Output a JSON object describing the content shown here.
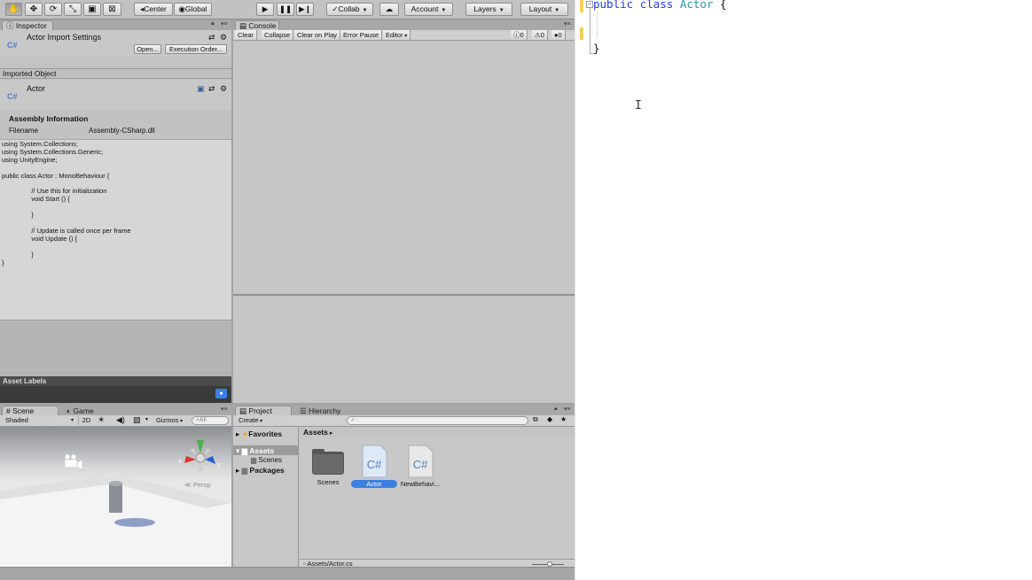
{
  "toolbar": {
    "tools": [
      "hand-tool",
      "move-tool",
      "rotate-tool",
      "scale-tool",
      "rect-tool",
      "transform-tool"
    ],
    "pivot_label": "Center",
    "space_label": "Global",
    "collab_label": "Collab",
    "account_label": "Account",
    "layers_label": "Layers",
    "layout_label": "Layout"
  },
  "inspector": {
    "tab_label": "Inspector",
    "title": "Actor Import Settings",
    "icon_text": "C#",
    "open_button": "Open...",
    "execution_order_button": "Execution Order...",
    "imported_object_header": "Imported Object",
    "object_name": "Actor",
    "assembly_header": "Assembly Information",
    "filename_label": "Filename",
    "filename_value": "Assembly-CSharp.dll",
    "code_preview": "using System.Collections;\nusing System.Collections.Generic;\nusing UnityEngine;\n\npublic class Actor : MonoBehaviour {\n\n\t\t// Use this for initialization\n\t\tvoid Start () {\n\n\t\t}\n\n\t\t// Update is called once per frame\n\t\tvoid Update () {\n\n\t\t}\n}",
    "asset_labels_header": "Asset Labels"
  },
  "console": {
    "tab_label": "Console",
    "buttons": [
      "Clear",
      "Collapse",
      "Clear on Play",
      "Error Pause",
      "Editor"
    ],
    "info_count": "0",
    "warning_count": "0",
    "error_count": "0"
  },
  "scene": {
    "tab_scene": "Scene",
    "tab_game": "Game",
    "shading_mode": "Shaded",
    "mode_2d": "2D",
    "gizmos_label": "Gizmos",
    "search_all": "All",
    "persp_label": "Persp",
    "axis_x": "x",
    "axis_z": "z"
  },
  "project": {
    "tab_project": "Project",
    "tab_hierarchy": "Hierarchy",
    "create_label": "Create",
    "favorites_label": "Favorites",
    "tree": [
      "Assets",
      "Scenes",
      "Packages"
    ],
    "breadcrumb": "Assets",
    "assets": [
      {
        "name": "Scenes",
        "type": "folder"
      },
      {
        "name": "Actor",
        "type": "script",
        "selected": true
      },
      {
        "name": "NewBehavi...",
        "type": "script",
        "selected": false
      }
    ],
    "status_path": "Assets/Actor.cs"
  },
  "editor": {
    "line1_kw1": "public",
    "line1_kw2": "class",
    "line1_type": "Actor",
    "line1_brace": "{",
    "closing_brace": "}",
    "cursor_glyph": "I"
  },
  "colors": {
    "unity_bg": "#c2c2c2",
    "selection_blue": "#3c7fe0",
    "keyword_blue": "#1f3fd1",
    "type_teal": "#2b91af"
  }
}
